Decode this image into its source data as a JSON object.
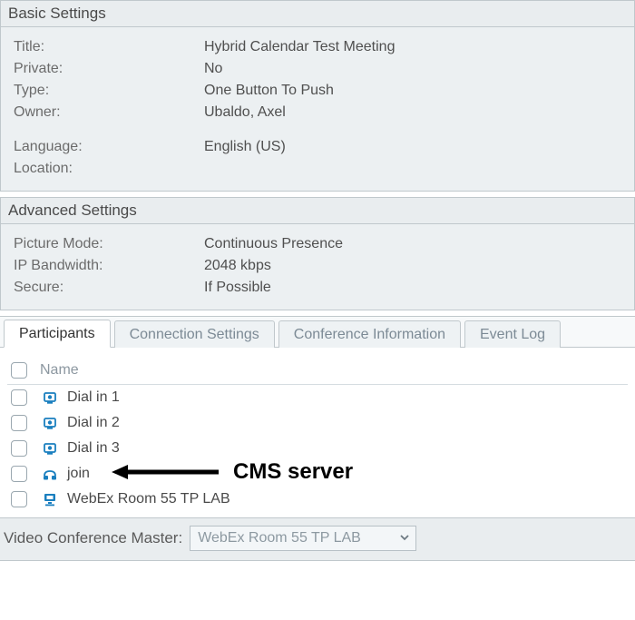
{
  "basic": {
    "title": "Basic Settings",
    "rows": [
      {
        "label": "Title:",
        "value": "Hybrid Calendar Test Meeting"
      },
      {
        "label": "Private:",
        "value": "No"
      },
      {
        "label": "Type:",
        "value": "One Button To Push"
      },
      {
        "label": "Owner:",
        "value": "Ubaldo, Axel"
      }
    ],
    "rows2": [
      {
        "label": "Language:",
        "value": "English (US)"
      },
      {
        "label": "Location:",
        "value": ""
      }
    ]
  },
  "advanced": {
    "title": "Advanced Settings",
    "rows": [
      {
        "label": "Picture Mode:",
        "value": "Continuous Presence"
      },
      {
        "label": "IP Bandwidth:",
        "value": "2048 kbps"
      },
      {
        "label": "Secure:",
        "value": "If Possible"
      }
    ]
  },
  "tabs": {
    "items": [
      {
        "label": "Participants",
        "active": true
      },
      {
        "label": "Connection Settings",
        "active": false
      },
      {
        "label": "Conference Information",
        "active": false
      },
      {
        "label": "Event Log",
        "active": false
      }
    ]
  },
  "participants": {
    "header": "Name",
    "rows": [
      {
        "icon": "dialin-icon",
        "label": "Dial in 1"
      },
      {
        "icon": "dialin-icon",
        "label": "Dial in 2"
      },
      {
        "icon": "dialin-icon",
        "label": "Dial in 3"
      },
      {
        "icon": "join-icon",
        "label": "join"
      },
      {
        "icon": "endpoint-icon",
        "label": "WebEx Room 55 TP LAB"
      }
    ]
  },
  "footer": {
    "label": "Video Conference Master:",
    "selected": "WebEx Room 55 TP LAB"
  },
  "annotation": {
    "text": "CMS server"
  }
}
